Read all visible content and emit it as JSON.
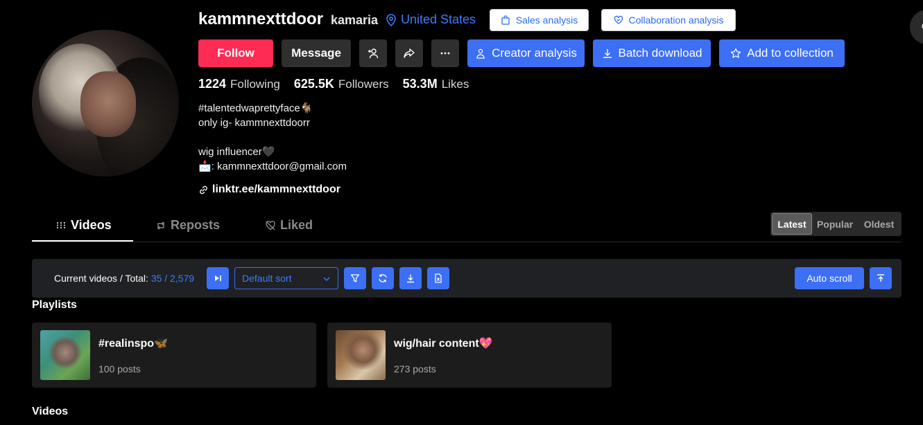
{
  "profile": {
    "username": "kammnexttdoor",
    "nickname": "kamaria",
    "location": "United States",
    "avatar_icon": "profile-photo"
  },
  "header_buttons": {
    "sales_analysis": "Sales analysis",
    "collaboration_analysis": "Collaboration analysis"
  },
  "actions": {
    "follow": "Follow",
    "message": "Message",
    "creator_analysis": "Creator analysis",
    "batch_download": "Batch download",
    "add_to_collection": "Add to collection"
  },
  "stats": {
    "following_count": "1224",
    "following_label": "Following",
    "followers_count": "625.5K",
    "followers_label": "Followers",
    "likes_count": "53.3M",
    "likes_label": "Likes"
  },
  "bio": {
    "line1": "#talentedwaprettyface🐐",
    "line2": "only ig- kammnexttdoorr",
    "line3": "wig influencer🖤",
    "line4": "📩: kammnexttdoor@gmail.com"
  },
  "link": "linktr.ee/kammnexttdoor",
  "tabs": [
    {
      "label": "Videos",
      "icon": "bars-icon",
      "active": true
    },
    {
      "label": "Reposts",
      "icon": "repost-icon",
      "active": false
    },
    {
      "label": "Liked",
      "icon": "heart-off-icon",
      "active": false
    }
  ],
  "sort_options": [
    {
      "label": "Latest",
      "active": true
    },
    {
      "label": "Popular",
      "active": false
    },
    {
      "label": "Oldest",
      "active": false
    }
  ],
  "toolbar": {
    "count_label": "Current videos / Total:",
    "count_value": "35 / 2,579",
    "sort_select": "Default sort",
    "auto_scroll": "Auto scroll"
  },
  "sections": {
    "playlists": "Playlists",
    "videos": "Videos"
  },
  "playlists": [
    {
      "title": "#realinspo🦋",
      "count": "100 posts"
    },
    {
      "title": "wig/hair content💖",
      "count": "273 posts"
    }
  ],
  "colors": {
    "accent_blue": "#3d6ff5",
    "follow_red": "#fe2c55",
    "background": "#000000"
  }
}
